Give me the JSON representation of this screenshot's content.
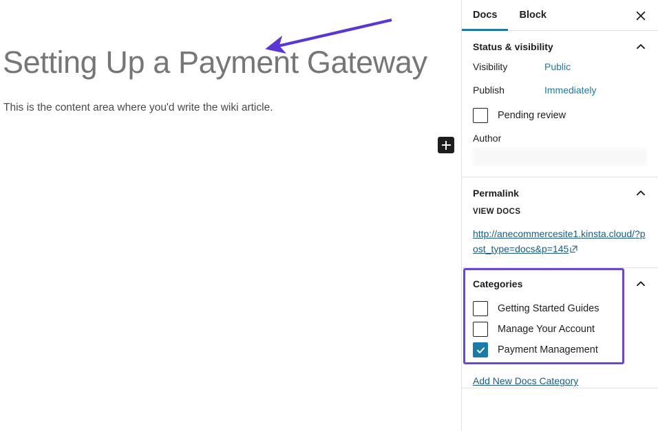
{
  "editor": {
    "post_title": "Setting Up a Payment Gateway",
    "post_body": "This is the content area where you'd write the wiki article.",
    "inserter_label": "+",
    "annotation_arrow": "purple-arrow-pointing-to-title"
  },
  "sidebar": {
    "tabs": [
      {
        "label": "Docs",
        "active": true
      },
      {
        "label": "Block",
        "active": false
      }
    ],
    "close_label": "Close settings",
    "panels": {
      "status_visibility": {
        "title": "Status & visibility",
        "rows": [
          {
            "label": "Visibility",
            "value": "Public"
          },
          {
            "label": "Publish",
            "value": "Immediately"
          }
        ],
        "pending_review": {
          "label": "Pending review",
          "checked": false
        },
        "author_label": "Author",
        "author_value": ""
      },
      "permalink": {
        "title": "Permalink",
        "view_label": "VIEW DOCS",
        "url": "http://anecommercesite1.kinsta.cloud/?post_type=docs&p=145"
      },
      "categories": {
        "title": "Categories",
        "items": [
          {
            "label": "Getting Started Guides",
            "checked": false
          },
          {
            "label": "Manage Your Account",
            "checked": false
          },
          {
            "label": "Payment Management",
            "checked": true
          }
        ],
        "add_link": "Add New Docs Category"
      }
    }
  },
  "colors": {
    "accent_blue": "#1a7aa8",
    "link_blue": "#1a5b8a",
    "highlight_purple": "#6b46d6",
    "arrow_purple": "#5b35d5",
    "title_gray": "#767676",
    "inserter_black": "#1e1e1e"
  }
}
